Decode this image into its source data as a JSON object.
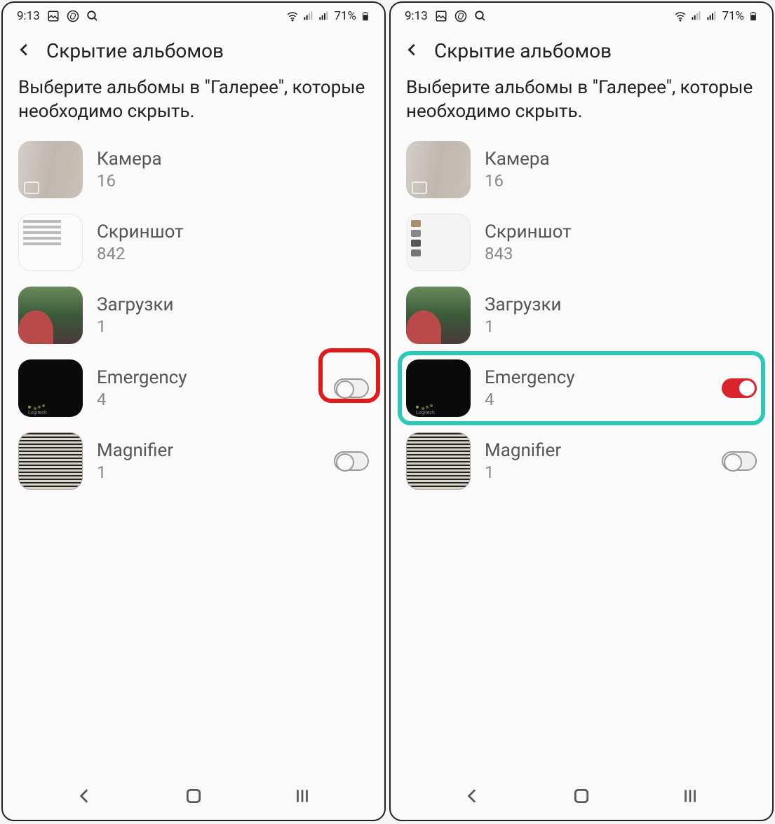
{
  "status": {
    "time": "9:13",
    "battery": "71%"
  },
  "left": {
    "title": "Скрытие альбомов",
    "description": "Выберите альбомы в \"Галерее\", которые необходимо скрыть.",
    "albums": [
      {
        "name": "Камера",
        "count": "16",
        "toggle": null
      },
      {
        "name": "Скриншот",
        "count": "842",
        "toggle": null
      },
      {
        "name": "Загрузки",
        "count": "1",
        "toggle": null
      },
      {
        "name": "Emergency",
        "count": "4",
        "toggle": "off",
        "highlight": "red"
      },
      {
        "name": "Magnifier",
        "count": "1",
        "toggle": "off"
      }
    ]
  },
  "right": {
    "title": "Скрытие альбомов",
    "description": "Выберите альбомы в \"Галерее\", которые необходимо скрыть.",
    "albums": [
      {
        "name": "Камера",
        "count": "16",
        "toggle": null
      },
      {
        "name": "Скриншот",
        "count": "843",
        "toggle": null
      },
      {
        "name": "Загрузки",
        "count": "1",
        "toggle": null
      },
      {
        "name": "Emergency",
        "count": "4",
        "toggle": "on",
        "highlight": "teal"
      },
      {
        "name": "Magnifier",
        "count": "1",
        "toggle": "off"
      }
    ]
  }
}
